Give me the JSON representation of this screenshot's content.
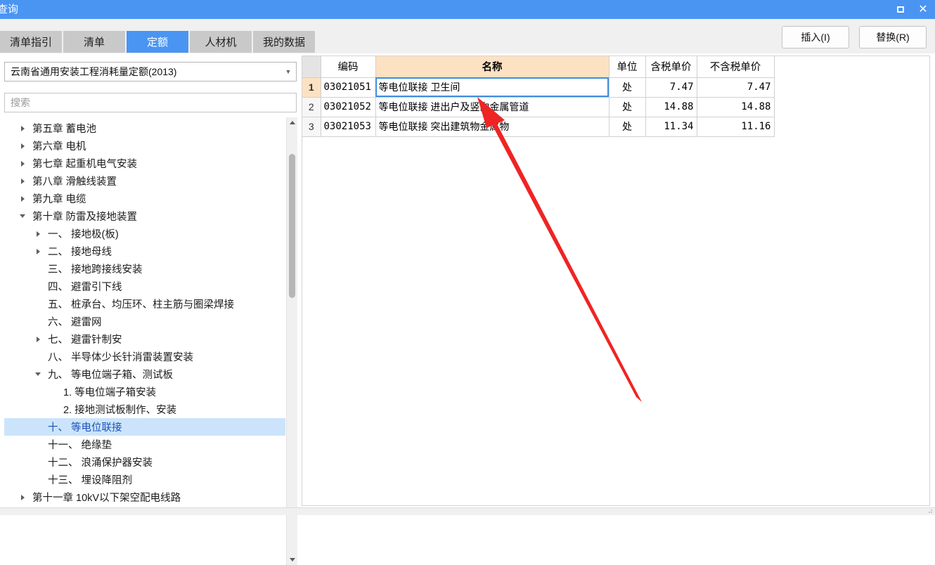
{
  "window": {
    "title": "查询",
    "maximize_icon": "maximize-icon",
    "close_icon": "close-icon"
  },
  "tabs": [
    {
      "label": "清单指引",
      "active": false
    },
    {
      "label": "清单",
      "active": false
    },
    {
      "label": "定额",
      "active": true
    },
    {
      "label": "人材机",
      "active": false
    },
    {
      "label": "我的数据",
      "active": false
    }
  ],
  "toolbar": {
    "insert_label": "插入(I)",
    "replace_label": "替换(R)"
  },
  "left": {
    "library_select": "云南省通用安装工程消耗量定额(2013)",
    "dropdown_icon": "chevron-down-icon",
    "search_placeholder": "搜索",
    "search_value": ""
  },
  "tree": [
    {
      "label": "第五章 蓄电池",
      "indent": 0,
      "state": "collapsed",
      "selected": false
    },
    {
      "label": "第六章 电机",
      "indent": 0,
      "state": "collapsed",
      "selected": false
    },
    {
      "label": "第七章 起重机电气安装",
      "indent": 0,
      "state": "collapsed",
      "selected": false
    },
    {
      "label": "第八章 滑触线装置",
      "indent": 0,
      "state": "collapsed",
      "selected": false
    },
    {
      "label": "第九章 电缆",
      "indent": 0,
      "state": "collapsed",
      "selected": false
    },
    {
      "label": "第十章 防雷及接地装置",
      "indent": 0,
      "state": "expanded",
      "selected": false
    },
    {
      "label": "一、 接地极(板)",
      "indent": 1,
      "state": "collapsed",
      "selected": false
    },
    {
      "label": "二、 接地母线",
      "indent": 1,
      "state": "collapsed",
      "selected": false
    },
    {
      "label": "三、 接地跨接线安装",
      "indent": 1,
      "state": "leaf",
      "selected": false
    },
    {
      "label": "四、 避雷引下线",
      "indent": 1,
      "state": "leaf",
      "selected": false
    },
    {
      "label": "五、 桩承台、均压环、柱主筋与圈梁焊接",
      "indent": 1,
      "state": "leaf",
      "selected": false
    },
    {
      "label": "六、 避雷网",
      "indent": 1,
      "state": "leaf",
      "selected": false
    },
    {
      "label": "七、 避雷针制安",
      "indent": 1,
      "state": "collapsed",
      "selected": false
    },
    {
      "label": "八、 半导体少长针消雷装置安装",
      "indent": 1,
      "state": "leaf",
      "selected": false
    },
    {
      "label": "九、 等电位端子箱、测试板",
      "indent": 1,
      "state": "expanded",
      "selected": false
    },
    {
      "label": "1. 等电位端子箱安装",
      "indent": 2,
      "state": "leaf",
      "selected": false
    },
    {
      "label": "2. 接地测试板制作、安装",
      "indent": 2,
      "state": "leaf",
      "selected": false
    },
    {
      "label": "十、 等电位联接",
      "indent": 1,
      "state": "leaf",
      "selected": true
    },
    {
      "label": "十一、 绝缘垫",
      "indent": 1,
      "state": "leaf",
      "selected": false
    },
    {
      "label": "十二、 浪涌保护器安装",
      "indent": 1,
      "state": "leaf",
      "selected": false
    },
    {
      "label": "十三、 埋设降阻剂",
      "indent": 1,
      "state": "leaf",
      "selected": false
    },
    {
      "label": "第十一章 10kV以下架空配电线路",
      "indent": 0,
      "state": "collapsed",
      "selected": false
    }
  ],
  "grid": {
    "columns": [
      "",
      "编码",
      "名称",
      "单位",
      "含税单价",
      "不含税单价"
    ],
    "rows": [
      {
        "num": "1",
        "code": "03021051",
        "name": "等电位联接 卫生间",
        "unit": "处",
        "price_tax": "7.47",
        "price_notax": "7.47",
        "selected": true
      },
      {
        "num": "2",
        "code": "03021052",
        "name": "等电位联接 进出户及竖向金属管道",
        "unit": "处",
        "price_tax": "14.88",
        "price_notax": "14.88",
        "selected": false
      },
      {
        "num": "3",
        "code": "03021053",
        "name": "等电位联接 突出建筑物金属物",
        "unit": "处",
        "price_tax": "11.34",
        "price_notax": "11.16",
        "selected": false
      }
    ]
  },
  "annotation": {
    "arrow_color": "#ef2424",
    "arrow_name": "red-pointer-arrow"
  },
  "colors": {
    "accent": "#4a95f2",
    "tab_inactive": "#c9c9c9",
    "name_header": "#fde1c3",
    "tree_selected": "#cce4fb"
  }
}
